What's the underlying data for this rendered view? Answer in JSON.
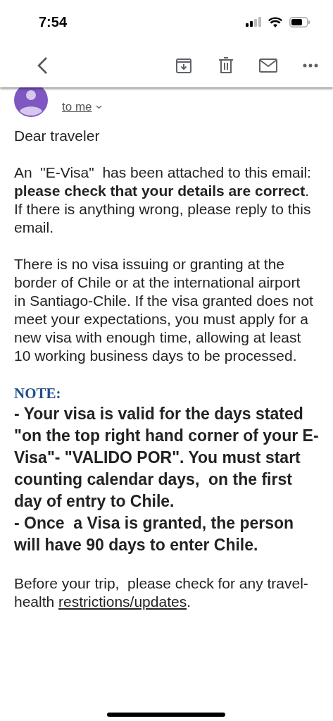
{
  "status_bar": {
    "time": "7:54"
  },
  "recipient": "to me",
  "body": [
    {
      "kind": "text",
      "text": "Dear traveler"
    },
    {
      "kind": "text",
      "text": "An  \"E-Visa\"  has been attached to this email: **please check that your details are correct**. If there is anything wrong, please reply to this email."
    },
    {
      "kind": "text",
      "text": "There is no visa issuing or granting at the border of Chile or at the international airport  in Santiago-Chile. If the visa granted does not meet your expectations, you must apply for a new visa with enough time, allowing at least 10 working business days to be processed."
    },
    {
      "kind": "note",
      "heading": "NOTE:",
      "items": [
        "- Your visa is valid for the days stated \"on the top right hand corner of your E-Visa\"- \"VALIDO POR\". You must start counting calendar days,  on the first day of entry to Chile.",
        "- Once  a Visa is granted, the person will have 90 days to enter Chile."
      ]
    },
    {
      "kind": "link",
      "before": "Before your trip,  please check for any travel-health ",
      "link": "restrictions/updates",
      "after": "."
    }
  ]
}
